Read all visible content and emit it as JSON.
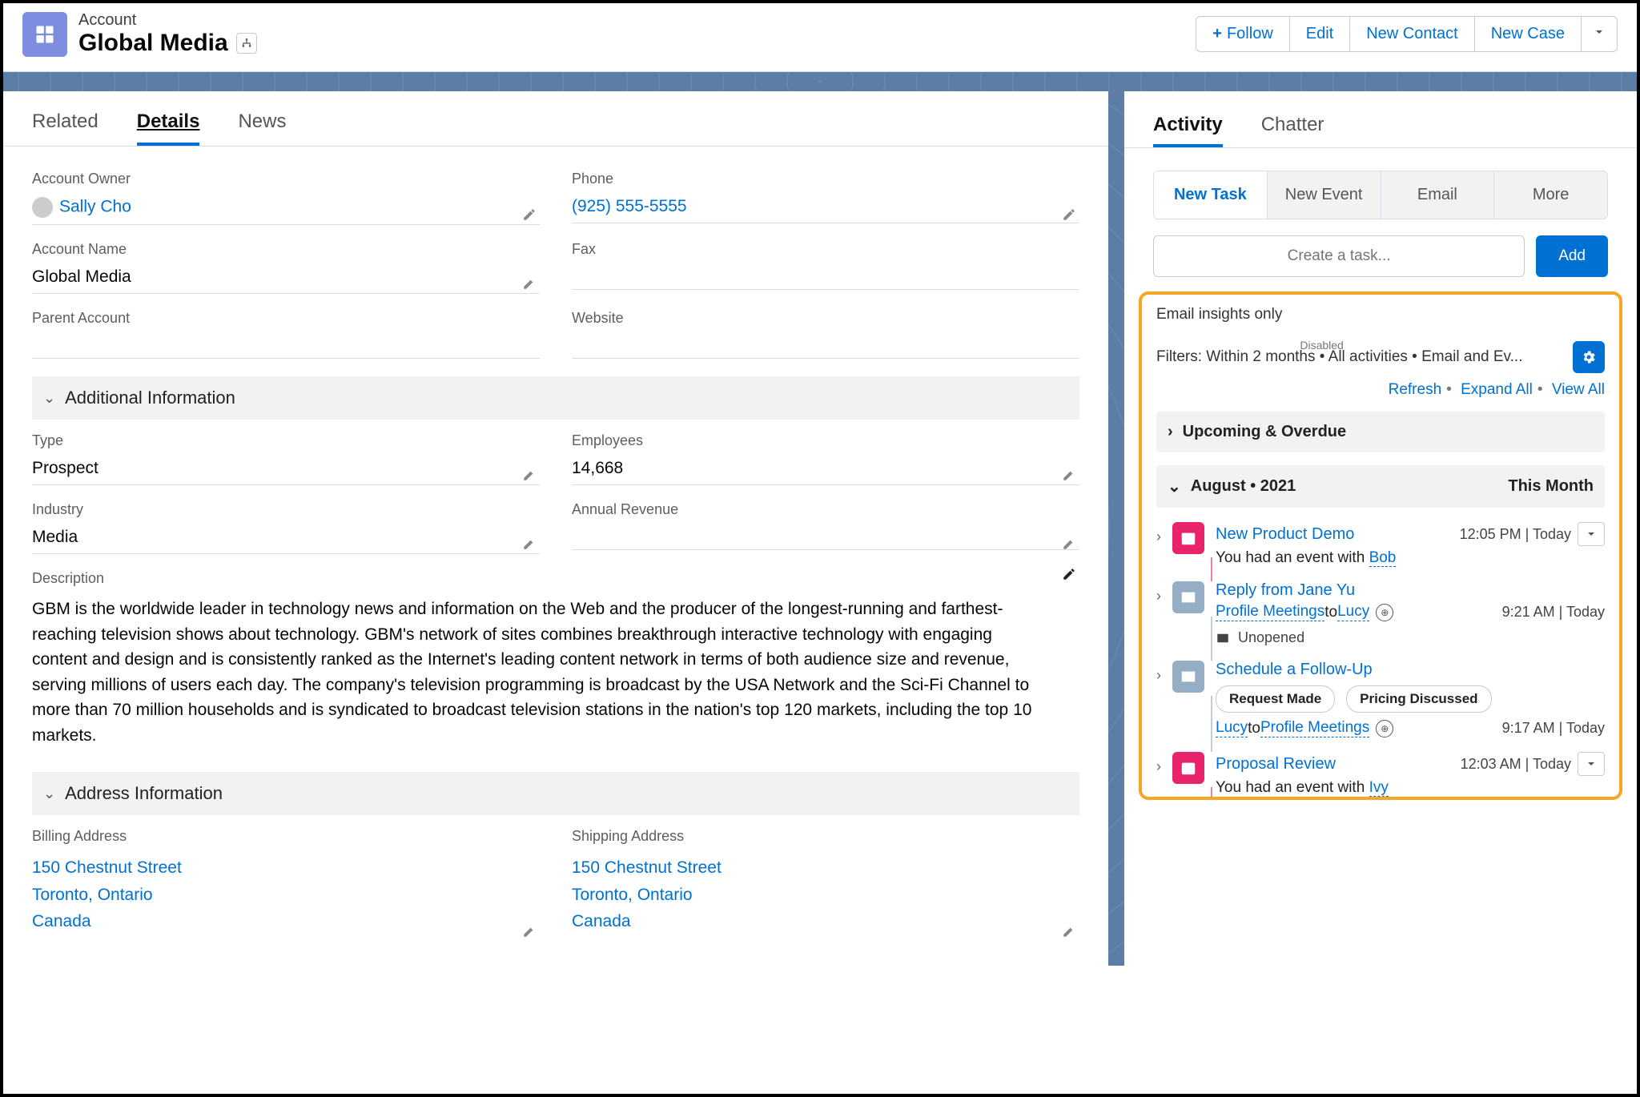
{
  "header": {
    "object_label": "Account",
    "record_name": "Global Media",
    "actions": {
      "follow": "Follow",
      "edit": "Edit",
      "new_contact": "New Contact",
      "new_case": "New Case"
    }
  },
  "left_tabs": {
    "related": "Related",
    "details": "Details",
    "news": "News"
  },
  "details": {
    "owner_label": "Account Owner",
    "owner_value": "Sally Cho",
    "phone_label": "Phone",
    "phone_value": "(925) 555-5555",
    "name_label": "Account Name",
    "name_value": "Global Media",
    "fax_label": "Fax",
    "fax_value": "",
    "parent_label": "Parent Account",
    "parent_value": "",
    "website_label": "Website",
    "website_value": "",
    "additional_section": "Additional Information",
    "type_label": "Type",
    "type_value": "Prospect",
    "employees_label": "Employees",
    "employees_value": "14,668",
    "industry_label": "Industry",
    "industry_value": "Media",
    "revenue_label": "Annual Revenue",
    "revenue_value": "",
    "description_label": "Description",
    "description_value": "GBM is the worldwide leader in technology news and information on the Web and the producer of the longest-running and farthest-reaching television shows about technology. GBM's network of sites combines breakthrough interactive technology with engaging content and design and is consistently ranked as the Internet's leading content network in terms of both audience size and revenue, serving millions of users each day. The company's television programming is broadcast by the USA Network and the Sci-Fi Channel to more than 70 million households and is syndicated to broadcast television stations in the nation's top 120 markets, including the top 10 markets.",
    "address_section": "Address Information",
    "billing_label": "Billing Address",
    "shipping_label": "Shipping Address",
    "addr_street": "150 Chestnut Street",
    "addr_city": "Toronto, Ontario",
    "addr_country": "Canada"
  },
  "right_tabs": {
    "activity": "Activity",
    "chatter": "Chatter"
  },
  "subtabs": {
    "new_task": "New Task",
    "new_event": "New Event",
    "email": "Email",
    "more": "More"
  },
  "task": {
    "placeholder": "Create a task...",
    "add": "Add"
  },
  "insights": {
    "label": "Email insights only",
    "toggle_state": "Disabled",
    "filters": "Filters: Within 2 months • All activities • Email and Ev...",
    "refresh": "Refresh",
    "expand": "Expand All",
    "view_all": "View All"
  },
  "groups": {
    "upcoming": "Upcoming & Overdue",
    "month": "August • 2021",
    "month_badge": "This Month"
  },
  "items": [
    {
      "kind": "event",
      "title": "New Product Demo",
      "time": "12:05 PM | Today",
      "sub_prefix": "You had an event with ",
      "sub_link": "Bob"
    },
    {
      "kind": "email",
      "title_prefix": "Reply from ",
      "title_link": "Jane Yu",
      "link1": "Profile Meetings",
      "between": " to ",
      "link2": "Lucy",
      "time": "9:21 AM | Today",
      "status": "Unopened"
    },
    {
      "kind": "email",
      "title": "Schedule a Follow-Up",
      "chips": [
        "Request Made",
        "Pricing Discussed"
      ],
      "link1": "Lucy",
      "between": " to ",
      "link2": "Profile Meetings",
      "time": "9:17 AM | Today"
    },
    {
      "kind": "event",
      "title": "Proposal Review",
      "time": "12:03 AM | Today",
      "sub_prefix": "You had an event with ",
      "sub_link": "Ivy"
    }
  ]
}
